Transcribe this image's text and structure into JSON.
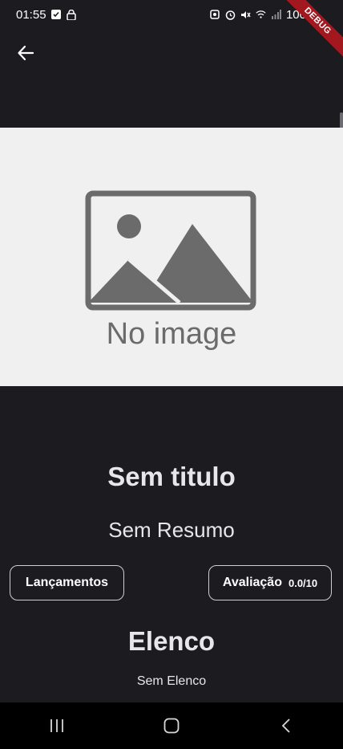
{
  "status_bar": {
    "time": "01:55",
    "battery": "100",
    "icons": [
      "check-box-icon",
      "lock-icon",
      "photo-icon",
      "alarm-icon",
      "mute-icon",
      "wifi-icon",
      "signal-icon"
    ]
  },
  "debug_banner": "DEBUG",
  "app_bar": {
    "back_icon": "arrow-back-icon"
  },
  "poster": {
    "placeholder_text": "No image",
    "background": "#f1f0f1",
    "graphic_color": "#6b6b6b"
  },
  "movie": {
    "title": "Sem titulo",
    "summary": "Sem Resumo",
    "release_label": "Lançamentos",
    "rating_label": "Avaliação",
    "rating_value": "0.0/10"
  },
  "cast": {
    "heading": "Elenco",
    "empty_text": "Sem Elenco"
  },
  "nav_bar": {
    "icons": [
      "recent-apps-icon",
      "home-icon",
      "back-icon"
    ]
  },
  "colors": {
    "background": "#1c1b20",
    "text": "#e8e6ed",
    "banner": "#a3181f"
  }
}
